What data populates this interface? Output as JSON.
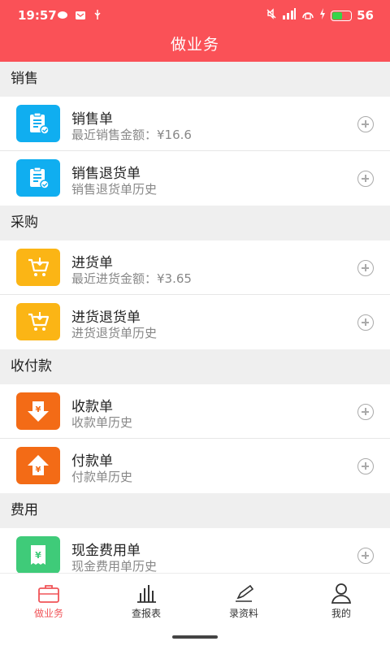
{
  "status": {
    "time": "19:57",
    "battery": "56",
    "battery_level": 0.56
  },
  "header": {
    "title": "做业务"
  },
  "sections": [
    {
      "title": "销售",
      "items": [
        {
          "title": "销售单",
          "subtitle": "最近销售金额：¥16.6"
        },
        {
          "title": "销售退货单",
          "subtitle": "销售退货单历史"
        }
      ]
    },
    {
      "title": "采购",
      "items": [
        {
          "title": "进货单",
          "subtitle": "最近进货金额：¥3.65"
        },
        {
          "title": "进货退货单",
          "subtitle": "进货退货单历史"
        }
      ]
    },
    {
      "title": "收付款",
      "items": [
        {
          "title": "收款单",
          "subtitle": "收款单历史"
        },
        {
          "title": "付款单",
          "subtitle": "付款单历史"
        }
      ]
    },
    {
      "title": "费用",
      "items": [
        {
          "title": "现金费用单",
          "subtitle": "现金费用单历史"
        }
      ]
    }
  ],
  "tabs": [
    {
      "label": "做业务",
      "icon": "briefcase-icon",
      "active": true
    },
    {
      "label": "查报表",
      "icon": "bar-chart-icon"
    },
    {
      "label": "录资料",
      "icon": "edit-icon"
    },
    {
      "label": "我的",
      "icon": "user-icon"
    }
  ],
  "colors": {
    "accent": "#fa5157",
    "blue": "#10aef0",
    "yellow": "#fbb515",
    "orange": "#f36b16",
    "green": "#3fcb79"
  }
}
